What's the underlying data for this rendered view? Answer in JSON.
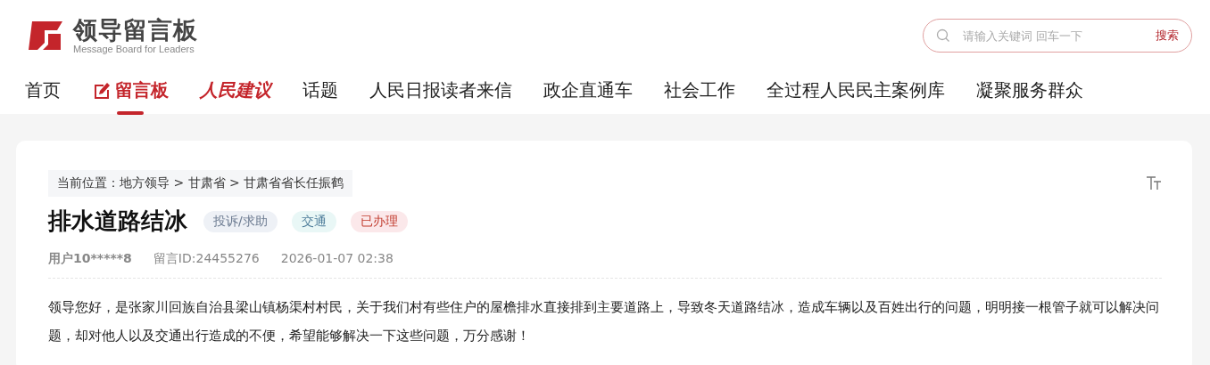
{
  "logo": {
    "title": "领导留言板",
    "subtitle": "Message Board for Leaders"
  },
  "search": {
    "placeholder": "请输入关键词 回车一下",
    "button": "搜索"
  },
  "nav": [
    {
      "label": "首页",
      "kind": "plain",
      "selected": false
    },
    {
      "label": "留言板",
      "kind": "icon",
      "selected": true
    },
    {
      "label": "人民建议",
      "kind": "brand",
      "selected": false
    },
    {
      "label": "话题",
      "kind": "plain",
      "selected": false
    },
    {
      "label": "人民日报读者来信",
      "kind": "plain",
      "selected": false
    },
    {
      "label": "政企直通车",
      "kind": "plain",
      "selected": false
    },
    {
      "label": "社会工作",
      "kind": "plain",
      "selected": false
    },
    {
      "label": "全过程人民民主案例库",
      "kind": "plain",
      "selected": false
    },
    {
      "label": "凝聚服务群众",
      "kind": "plain",
      "selected": false
    }
  ],
  "breadcrumb": {
    "label": "当前位置：",
    "items": [
      "地方领导",
      "甘肃省",
      "甘肃省省长任振鹤"
    ],
    "separator": ">"
  },
  "message": {
    "title": "排水道路结冰",
    "tags": [
      {
        "label": "投诉/求助",
        "kind": "type"
      },
      {
        "label": "交通",
        "kind": "field"
      },
      {
        "label": "已办理",
        "kind": "status"
      }
    ],
    "user": "用户10*****8",
    "id": "留言ID:24455276",
    "time": "2026-01-07 02:38",
    "body": "领导您好，是张家川回族自治县梁山镇杨渠村村民，关于我们村有些住户的屋檐排水直接排到主要道路上，导致冬天道路结冰，造成车辆以及百姓出行的问题，明明接一根管子就可以解决问题，却对他人以及交通出行造成的不便，希望能够解决一下这些问题，万分感谢！"
  }
}
